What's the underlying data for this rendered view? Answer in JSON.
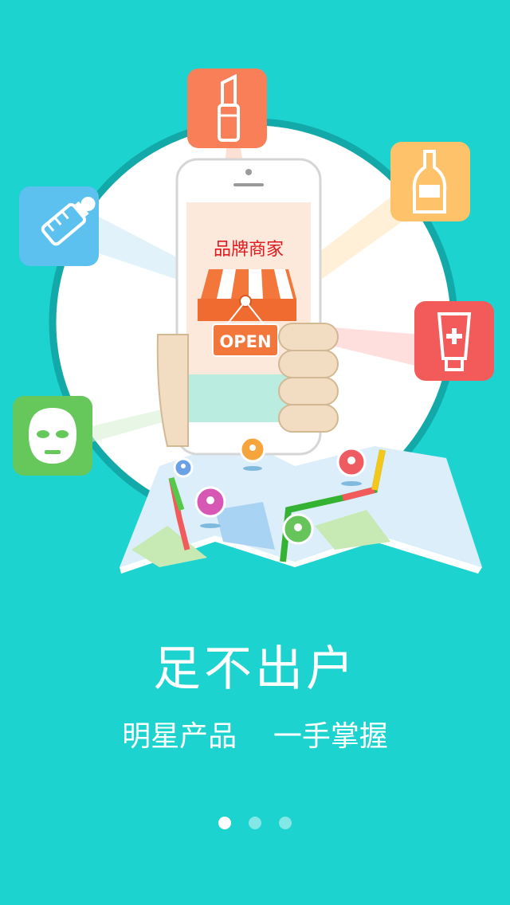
{
  "illustration": {
    "store_sign_title": "品牌商家",
    "open_sign_text": "OPEN"
  },
  "headline": "足不出户",
  "subline": "明星产品    一手掌握",
  "pager": {
    "count": 3,
    "active_index": 0
  },
  "colors": {
    "background": "#1cd3cf",
    "lipstick_tile": "#f97f58",
    "bottle_tile": "#fec36a",
    "cream_tile": "#f35a5a",
    "baby_bottle_tile": "#5cc1ef",
    "mask_tile": "#66c85a",
    "store_red": "#e0191f",
    "awning_orange": "#f3763a"
  }
}
